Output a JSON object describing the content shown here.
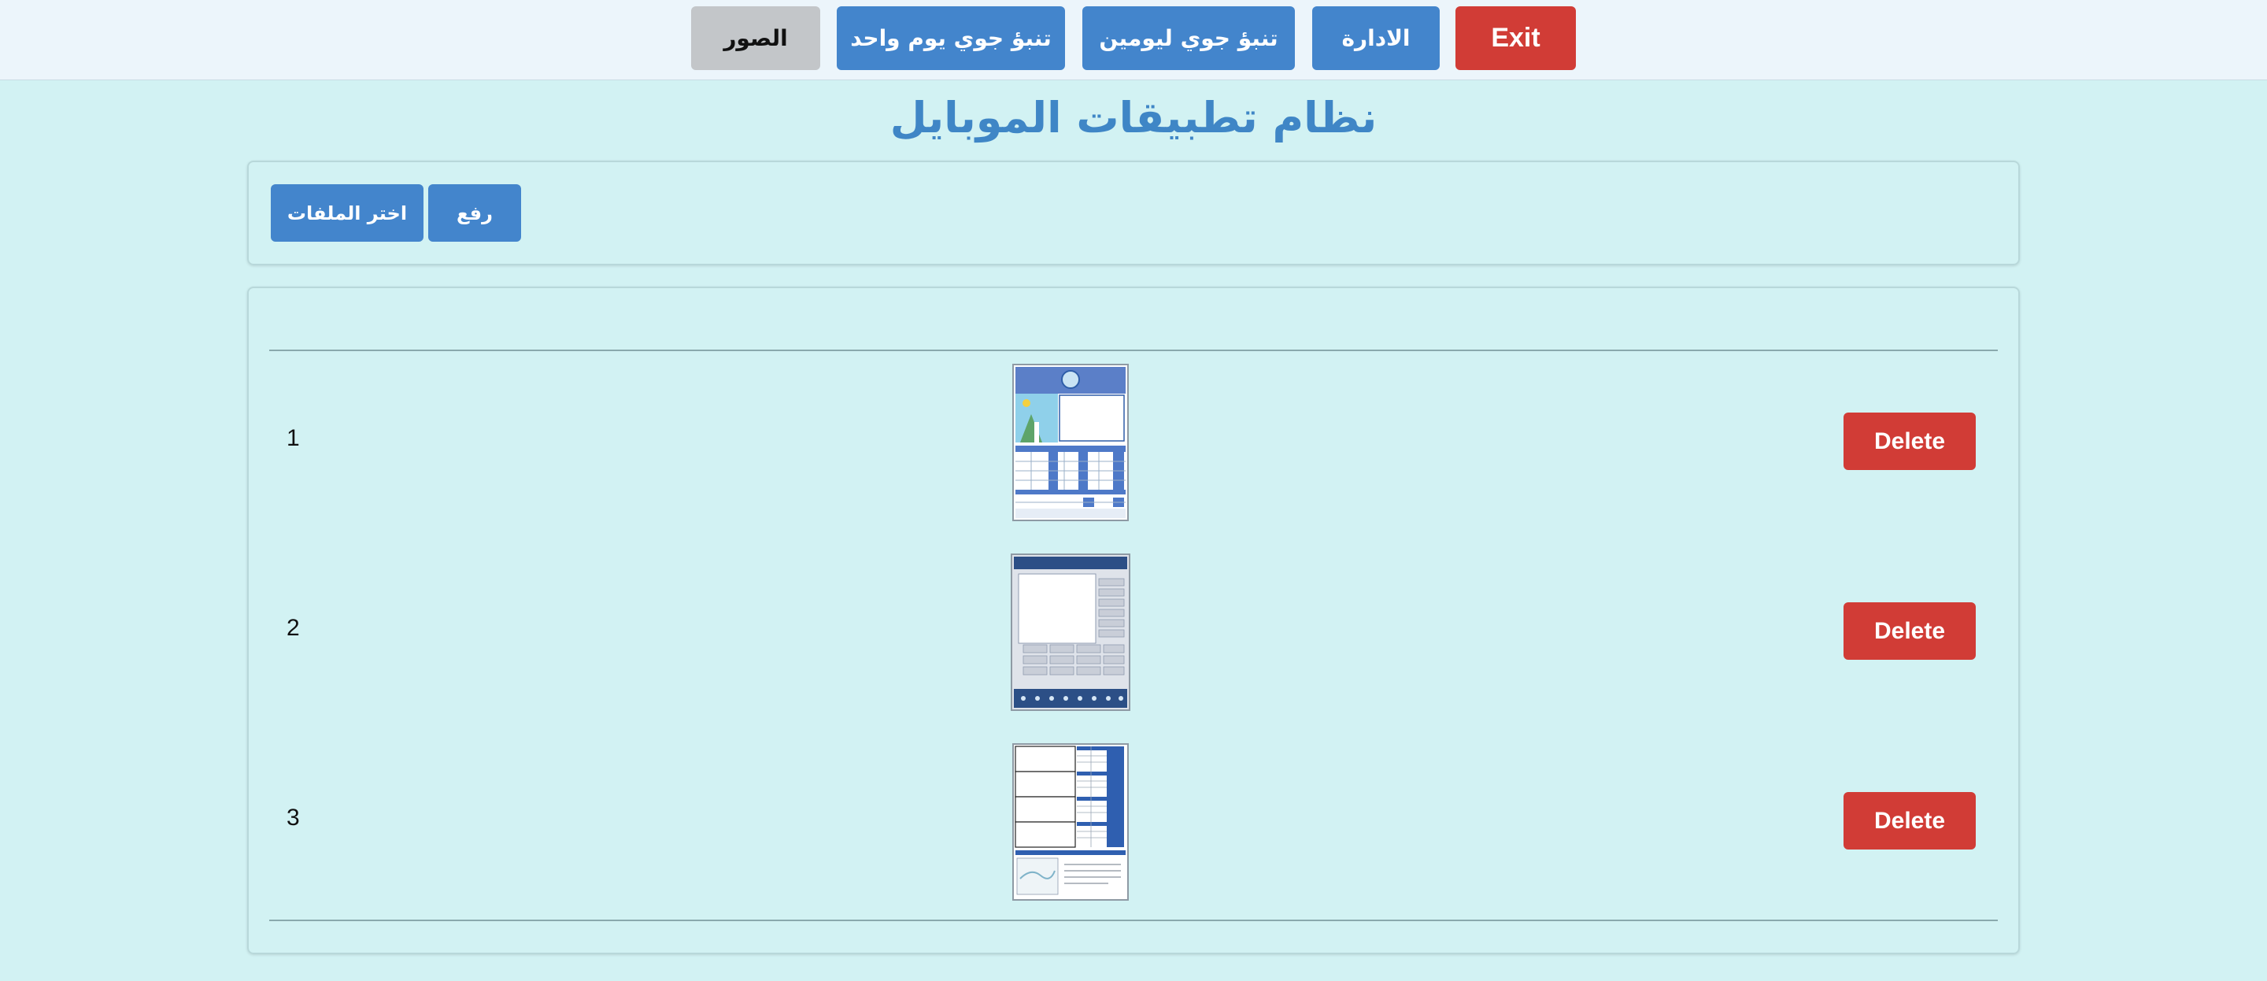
{
  "nav": {
    "images": "الصور",
    "forecast_one_day": "تنبؤ جوي يوم واحد",
    "forecast_two_days": "تنبؤ جوي ليومين",
    "admin": "الادارة",
    "exit": "Exit"
  },
  "page": {
    "title": "نظام تطبيقات الموبايل"
  },
  "upload": {
    "upload_label": "رفع",
    "choose_files_label": "اختر الملفات"
  },
  "files": [
    {
      "index": "1",
      "delete_label": "Delete",
      "thumbnail": "weather-forecast-table-thumbnail"
    },
    {
      "index": "2",
      "delete_label": "Delete",
      "thumbnail": "forecast-form-thumbnail"
    },
    {
      "index": "3",
      "delete_label": "Delete",
      "thumbnail": "forecast-grid-thumbnail"
    }
  ],
  "colors": {
    "accent_blue": "#4385cc",
    "danger_red": "#d13c36",
    "background": "#d2f2f3",
    "title_blue": "#3f86c6"
  }
}
